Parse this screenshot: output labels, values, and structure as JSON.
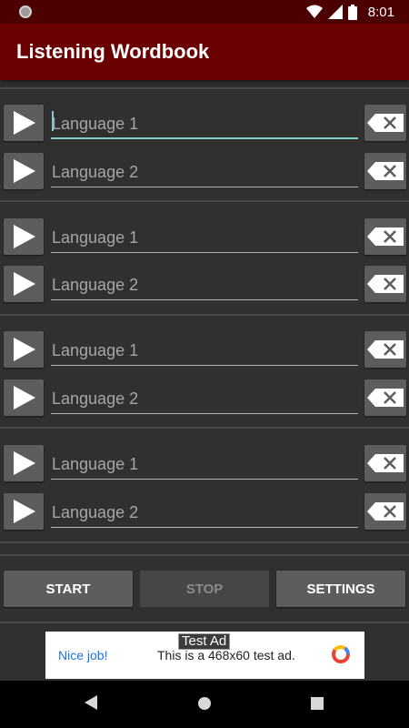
{
  "status_bar": {
    "time": "8:01",
    "icons": [
      "notification-dot-icon",
      "wifi-icon",
      "signal-icon",
      "battery-icon"
    ]
  },
  "app_bar": {
    "title": "Listening Wordbook"
  },
  "entries": [
    {
      "lang1_placeholder": "Language 1",
      "lang1_value": "",
      "lang2_placeholder": "Language 2",
      "lang2_value": ""
    },
    {
      "lang1_placeholder": "Language 1",
      "lang1_value": "",
      "lang2_placeholder": "Language 2",
      "lang2_value": ""
    },
    {
      "lang1_placeholder": "Language 1",
      "lang1_value": "",
      "lang2_placeholder": "Language 2",
      "lang2_value": ""
    },
    {
      "lang1_placeholder": "Language 1",
      "lang1_value": "",
      "lang2_placeholder": "Language 2",
      "lang2_value": ""
    }
  ],
  "controls": {
    "start_label": "START",
    "stop_label": "STOP",
    "settings_label": "SETTINGS"
  },
  "ad": {
    "label": "Test Ad",
    "cta": "Nice job!",
    "text": "This is a 468x60 test ad."
  },
  "colors": {
    "app_bar": "#6b0000",
    "status_bar": "#4d0000",
    "background": "#303030",
    "button": "#5d5d5d",
    "focus_accent": "#80cbc4"
  }
}
